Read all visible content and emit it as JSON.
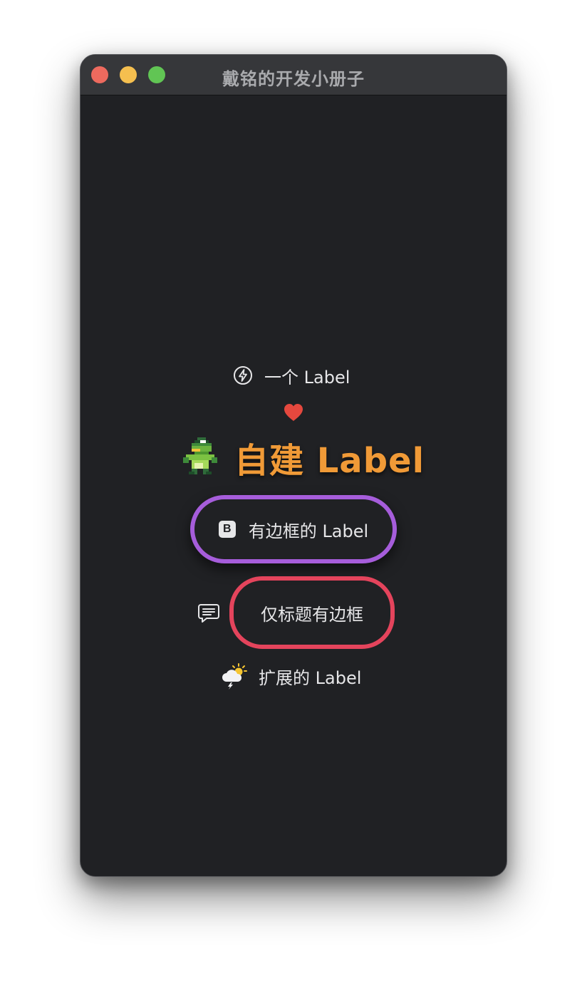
{
  "window": {
    "title": "戴铭的开发小册子"
  },
  "labels": {
    "simple": "一个 Label",
    "custom": "自建 Label",
    "bordered": "有边框的 Label",
    "bordered_icon_letter": "B",
    "title_only_border": "仅标题有边框",
    "extended": "扩展的 Label"
  },
  "icons": {
    "simple": "bolt-circle-icon",
    "heart": "heart-icon",
    "custom": "pixel-frog-sprite",
    "bordered": "b-square-icon",
    "title_only": "chat-bubble-icon",
    "extended": "cloud-sun-bolt-icon"
  },
  "colors": {
    "window_bg": "#202124",
    "titlebar_bg": "#36373a",
    "custom_label": "#f09a37",
    "bordered_stroke": "#a65ddb",
    "title_border_stroke": "#e4445c",
    "heart": "#e5483e"
  }
}
